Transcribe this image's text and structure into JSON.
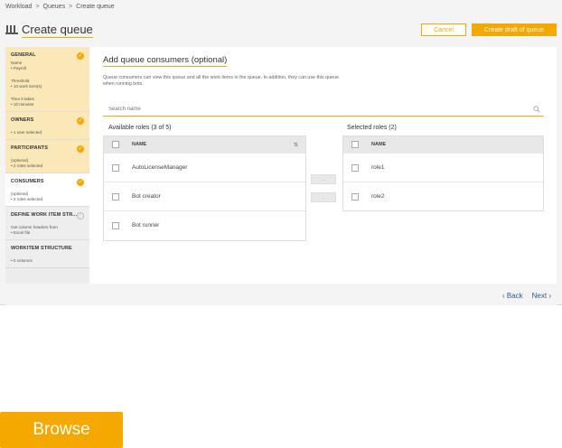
{
  "breadcrumb": {
    "items": [
      "Workload",
      "Queues",
      "Create queue"
    ],
    "sep": ">"
  },
  "header": {
    "title": "Create queue",
    "cancel_label": "Cancel",
    "create_label": "Create draft of queue"
  },
  "sidebar": {
    "steps": [
      {
        "title": "GENERAL",
        "lines": [
          "Name",
          "• Payroll",
          "Threshold",
          "• 10 work item(s)",
          "Time it takes",
          "• 10 minutes"
        ],
        "complete": true
      },
      {
        "title": "OWNERS",
        "lines": [
          "• 1 user selected"
        ],
        "complete": true
      },
      {
        "title": "PARTICIPANTS",
        "lines": [
          "(optional)",
          "• 2 roles selected"
        ],
        "complete": true
      },
      {
        "title": "CONSUMERS",
        "lines": [
          "(optional)",
          "• 2 roles selected"
        ],
        "complete": true
      },
      {
        "title": "DEFINE WORK ITEM STR...",
        "lines": [
          "Get column headers from",
          "• Excel file"
        ],
        "complete": false
      },
      {
        "title": "WORKITEM STRUCTURE",
        "lines": [
          "• 0 columns"
        ],
        "complete": false
      }
    ]
  },
  "main": {
    "section_title": "Add queue consumers (optional)",
    "description": "Queue consumers can view this queue and all the work items in the queue. In addition, they can use this queue when running bots.",
    "search_placeholder": "Search name",
    "available": {
      "label": "Available roles (3 of 5)",
      "header": "NAME",
      "rows": [
        "AutoLicenseManager",
        "Bot creator",
        "Bot runner"
      ]
    },
    "selected": {
      "label": "Selected roles (2)",
      "header": "NAME",
      "rows": [
        "role1",
        "role2"
      ]
    },
    "move_right": "→",
    "move_left": "←"
  },
  "footer": {
    "back": "Back",
    "next": "Next"
  },
  "browse_label": "Browse",
  "colors": {
    "accent": "#f5a800",
    "link": "#2a5a8a",
    "panel": "#f4f4f4"
  },
  "icons": {
    "title": "queue-icon",
    "search": "search-icon",
    "check": "check-icon",
    "sort": "sort-icon"
  }
}
